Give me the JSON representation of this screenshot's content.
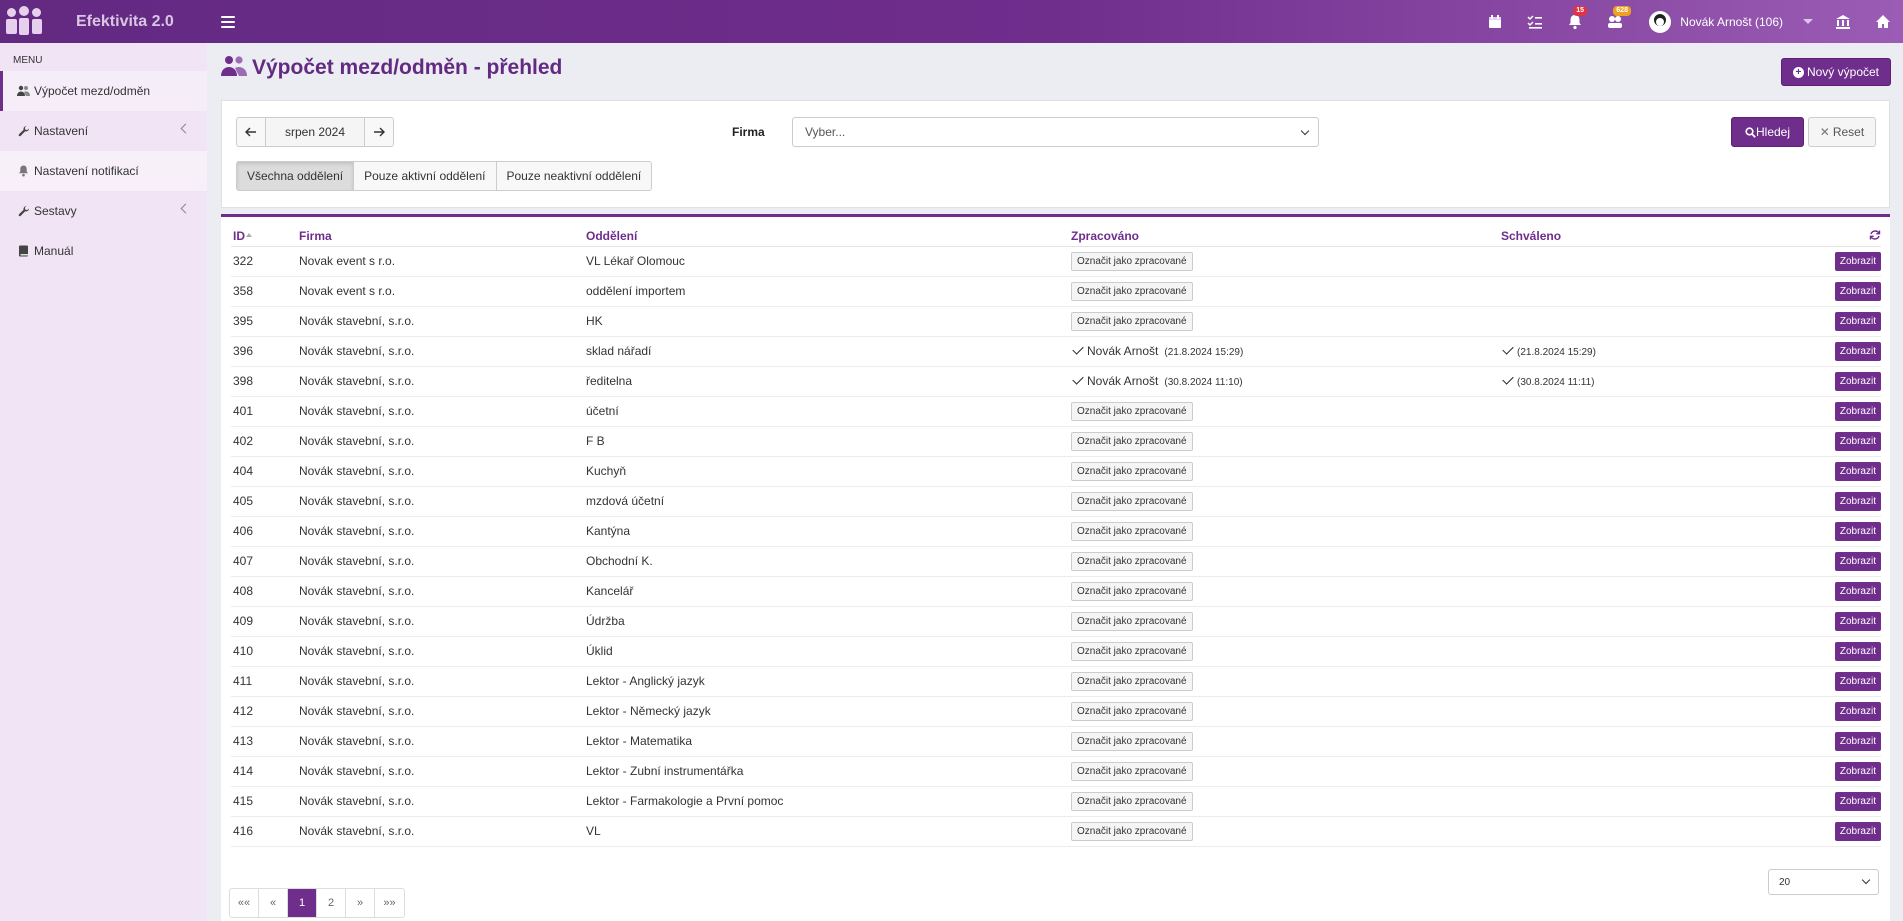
{
  "app": {
    "name": "Efektivita 2.0"
  },
  "header": {
    "notifications_count": "15",
    "messages_count": "628",
    "user_name": "Novák Arnošt (106)"
  },
  "sidebar": {
    "heading": "MENU",
    "items": [
      {
        "label": "Výpočet mezd/odměn",
        "icon": "users-icon"
      },
      {
        "label": "Nastavení",
        "icon": "wrench-icon"
      },
      {
        "label": "Nastavení notifikací",
        "icon": "bell-icon"
      },
      {
        "label": "Sestavy",
        "icon": "wrench-icon"
      },
      {
        "label": "Manuál",
        "icon": "book-icon"
      }
    ]
  },
  "page": {
    "title": "Výpočet mezd/odměn - přehled",
    "new_button": "Nový výpočet"
  },
  "filters": {
    "month": "srpen 2024",
    "firma_label": "Firma",
    "firma_placeholder": "Vyber...",
    "search_button": "Hledej",
    "reset_button": "Reset",
    "segments": [
      "Všechna oddělení",
      "Pouze aktivní oddělení",
      "Pouze neaktivní oddělení"
    ],
    "active_segment": "Všechna oddělení"
  },
  "table": {
    "columns": [
      "ID",
      "Firma",
      "Oddělení",
      "Zpracováno",
      "Schváleno"
    ],
    "mark_label": "Označit jako zpracované",
    "show_label": "Zobrazit",
    "rows": [
      {
        "id": "322",
        "firma": "Novak event s r.o.",
        "oddeleni": "VL Lékař Olomouc"
      },
      {
        "id": "358",
        "firma": "Novak event s r.o.",
        "oddeleni": "oddělení importem"
      },
      {
        "id": "395",
        "firma": "Novák stavební, s.r.o.",
        "oddeleni": "HK"
      },
      {
        "id": "396",
        "firma": "Novák stavební, s.r.o.",
        "oddeleni": "sklad nářadí",
        "zpracovano": {
          "name": "Novák Arnošt",
          "date": "(21.8.2024 15:29)"
        },
        "schvaleno": {
          "date": "(21.8.2024 15:29)"
        }
      },
      {
        "id": "398",
        "firma": "Novák stavební, s.r.o.",
        "oddeleni": "ředitelna",
        "zpracovano": {
          "name": "Novák Arnošt",
          "date": "(30.8.2024 11:10)"
        },
        "schvaleno": {
          "date": "(30.8.2024 11:11)"
        }
      },
      {
        "id": "401",
        "firma": "Novák stavební, s.r.o.",
        "oddeleni": "účetní"
      },
      {
        "id": "402",
        "firma": "Novák stavební, s.r.o.",
        "oddeleni": "F B"
      },
      {
        "id": "404",
        "firma": "Novák stavební, s.r.o.",
        "oddeleni": "Kuchyň"
      },
      {
        "id": "405",
        "firma": "Novák stavební, s.r.o.",
        "oddeleni": "mzdová účetní"
      },
      {
        "id": "406",
        "firma": "Novák stavební, s.r.o.",
        "oddeleni": "Kantýna"
      },
      {
        "id": "407",
        "firma": "Novák stavební, s.r.o.",
        "oddeleni": "Obchodní K."
      },
      {
        "id": "408",
        "firma": "Novák stavební, s.r.o.",
        "oddeleni": "Kancelář"
      },
      {
        "id": "409",
        "firma": "Novák stavební, s.r.o.",
        "oddeleni": "Údržba"
      },
      {
        "id": "410",
        "firma": "Novák stavební, s.r.o.",
        "oddeleni": "Úklid"
      },
      {
        "id": "411",
        "firma": "Novák stavební, s.r.o.",
        "oddeleni": "Lektor - Anglický jazyk"
      },
      {
        "id": "412",
        "firma": "Novák stavební, s.r.o.",
        "oddeleni": "Lektor - Německý jazyk"
      },
      {
        "id": "413",
        "firma": "Novák stavební, s.r.o.",
        "oddeleni": "Lektor - Matematika"
      },
      {
        "id": "414",
        "firma": "Novák stavební, s.r.o.",
        "oddeleni": "Lektor - Zubní instrumentářka"
      },
      {
        "id": "415",
        "firma": "Novák stavební, s.r.o.",
        "oddeleni": "Lektor - Farmakologie a První pomoc"
      },
      {
        "id": "416",
        "firma": "Novák stavební, s.r.o.",
        "oddeleni": "VL"
      }
    ]
  },
  "pagination": {
    "first": "««",
    "prev": "«",
    "pages": [
      "1",
      "2"
    ],
    "current": "1",
    "next": "»",
    "last": "»»",
    "page_size": "20"
  },
  "colors": {
    "brand": "#6f2d8c",
    "sidebar_bg": "#f1e4f5",
    "badge_red": "#dc3545",
    "badge_orange": "#f0a020"
  }
}
